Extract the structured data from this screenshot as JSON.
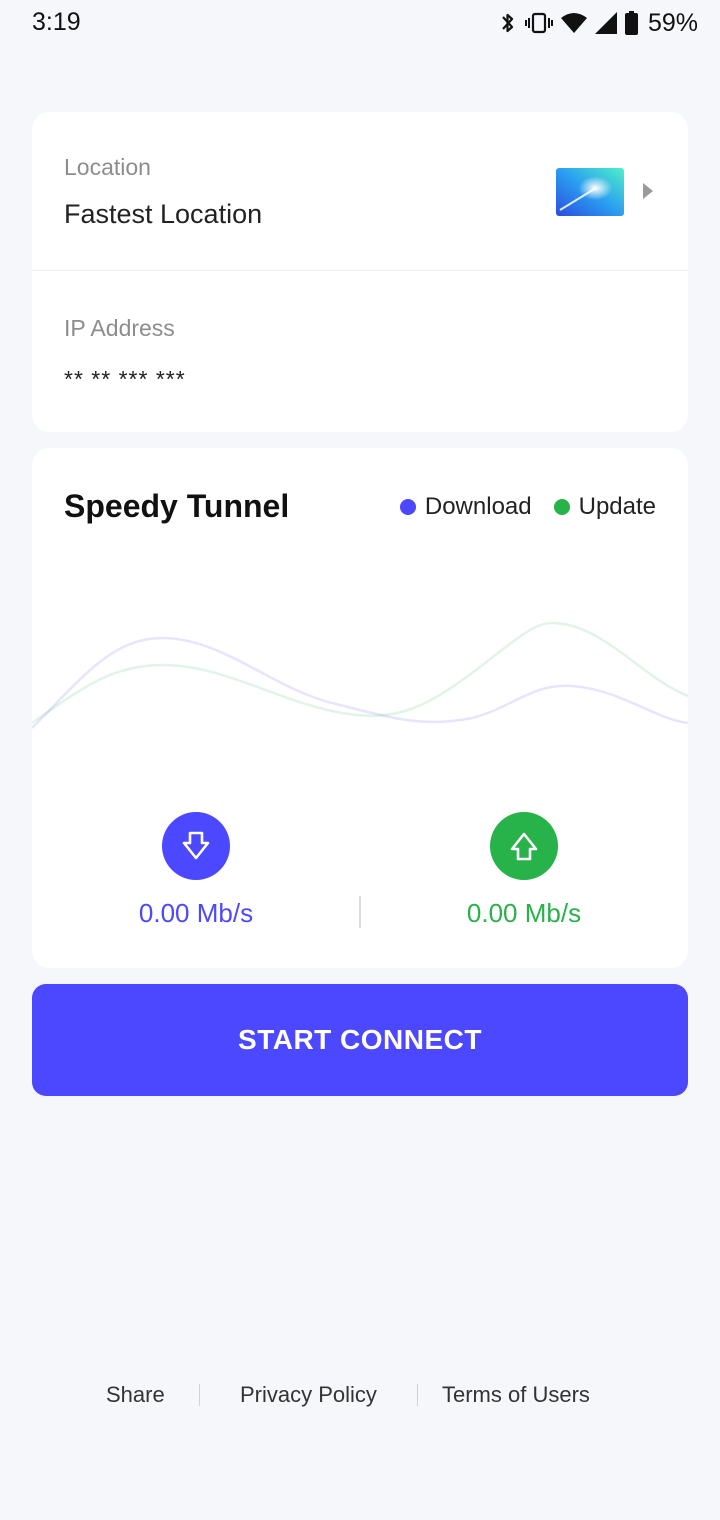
{
  "status_bar": {
    "time": "3:19",
    "battery_percent": "59%",
    "icons": [
      "bluetooth-icon",
      "vibrate-icon",
      "wifi-icon",
      "cell-signal-icon",
      "battery-icon"
    ]
  },
  "location_card": {
    "location_label": "Location",
    "location_value": "Fastest Location",
    "ip_label": "IP Address",
    "ip_value": "** ** *** ***"
  },
  "speed_card": {
    "title": "Speedy Tunnel",
    "legend": [
      {
        "label": "Download",
        "color": "#4b48ff"
      },
      {
        "label": "Update",
        "color": "#27b24a"
      }
    ],
    "download_speed": "0.00 Mb/s",
    "upload_speed": "0.00 Mb/s"
  },
  "connect_button": {
    "label": "START CONNECT"
  },
  "footer": {
    "share": "Share",
    "privacy": "Privacy Policy",
    "terms": "Terms of Users"
  },
  "colors": {
    "accent": "#4b48ff",
    "upload": "#27b24a",
    "background": "#f5f7fb"
  }
}
